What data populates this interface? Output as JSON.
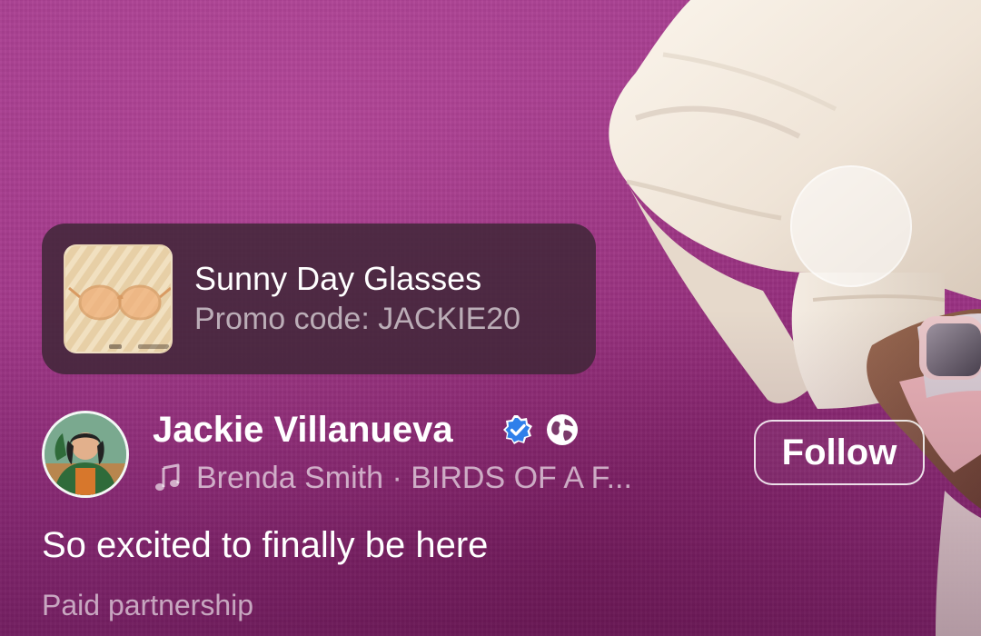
{
  "product": {
    "title": "Sunny Day Glasses",
    "promo": "Promo code: JACKIE20",
    "thumbnail_icon": "sunglasses-image"
  },
  "author": {
    "name": "Jackie Villanueva",
    "verified_icon": "verified-badge-icon",
    "audience_icon": "globe-icon",
    "avatar": "profile-photo"
  },
  "music": {
    "icon": "music-note-icon",
    "text": "Brenda Smith · BIRDS OF A F..."
  },
  "follow_label": "Follow",
  "caption": "So excited to finally be here",
  "paid_label": "Paid partnership",
  "colors": {
    "background": "#9c3385",
    "card": "#402638",
    "verified": "#1877f2",
    "text": "#ffffff"
  }
}
